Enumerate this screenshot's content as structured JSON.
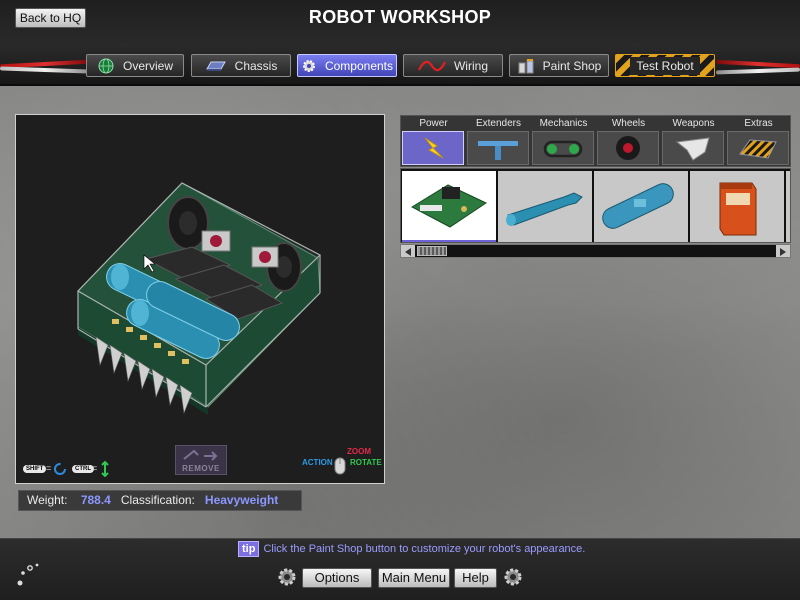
{
  "header": {
    "back_label": "Back to HQ",
    "title": "ROBOT WORKSHOP"
  },
  "tabs": [
    {
      "label": "Overview",
      "icon": "globe-icon",
      "active": false
    },
    {
      "label": "Chassis",
      "icon": "chassis-icon",
      "active": false
    },
    {
      "label": "Components",
      "icon": "gear-icon",
      "active": true
    },
    {
      "label": "Wiring",
      "icon": "wire-icon",
      "active": false
    },
    {
      "label": "Paint Shop",
      "icon": "paint-can-icon",
      "active": false
    },
    {
      "label": "Test Robot",
      "icon": "hazard-stripe",
      "active": false
    }
  ],
  "viewport": {
    "remove_label": "REMOVE",
    "shift_key": "SHIFT",
    "ctrl_key": "CTRL",
    "eq": "=",
    "action_label": "ACTION",
    "zoom_label": "ZOOM",
    "rotate_label": "ROTATE"
  },
  "stats": {
    "weight_label": "Weight:",
    "weight_value": "788.4",
    "class_label": "Classification:",
    "class_value": "Heavyweight"
  },
  "categories": [
    {
      "label": "Power",
      "icon": "lightning-icon",
      "active": true
    },
    {
      "label": "Extenders",
      "icon": "extender-icon",
      "active": false
    },
    {
      "label": "Mechanics",
      "icon": "chain-gear-icon",
      "active": false
    },
    {
      "label": "Wheels",
      "icon": "wheel-icon",
      "active": false
    },
    {
      "label": "Weapons",
      "icon": "blade-icon",
      "active": false
    },
    {
      "label": "Extras",
      "icon": "hazard-plate-icon",
      "active": false
    }
  ],
  "parts": [
    {
      "name": "circuit-board",
      "active": true
    },
    {
      "name": "blue-tank",
      "active": false
    },
    {
      "name": "co2-tank",
      "active": false
    },
    {
      "name": "orange-battery",
      "active": false
    }
  ],
  "tip": {
    "badge": "tip",
    "text": "Click the Paint Shop button to customize your robot's appearance."
  },
  "bottom": {
    "options_label": "Options",
    "main_menu_label": "Main Menu",
    "help_label": "Help"
  },
  "colors": {
    "accent": "#6d63d7",
    "stat_value": "#8b97ff",
    "tip_text": "#9a9cff",
    "hazard": "#e2a21c"
  }
}
